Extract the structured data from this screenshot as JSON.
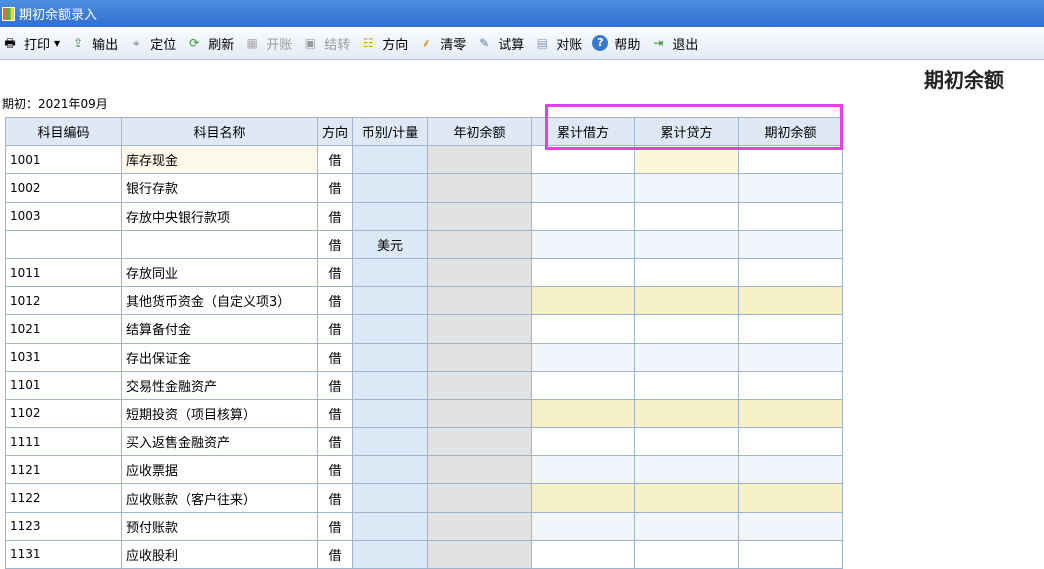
{
  "window": {
    "title": "期初余额录入"
  },
  "toolbar": {
    "items": [
      {
        "label": "打印",
        "icon": "printer-icon",
        "disabled": false,
        "dropdown": true
      },
      {
        "label": "输出",
        "icon": "export-icon",
        "disabled": false
      },
      {
        "label": "定位",
        "icon": "locate-icon",
        "disabled": false
      },
      {
        "label": "刷新",
        "icon": "refresh-icon",
        "disabled": false
      },
      {
        "label": "开账",
        "icon": "open-ledger-icon",
        "disabled": true
      },
      {
        "label": "结转",
        "icon": "carry-forward-icon",
        "disabled": true
      },
      {
        "label": "方向",
        "icon": "direction-icon",
        "disabled": false
      },
      {
        "label": "清零",
        "icon": "broom-icon",
        "disabled": false
      },
      {
        "label": "试算",
        "icon": "trial-balance-icon",
        "disabled": false
      },
      {
        "label": "对账",
        "icon": "reconcile-icon",
        "disabled": false
      },
      {
        "label": "帮助",
        "icon": "help-icon",
        "disabled": false
      },
      {
        "label": "退出",
        "icon": "exit-icon",
        "disabled": false
      }
    ]
  },
  "page": {
    "heading": "期初余额",
    "period_label": "期初：2021年09月"
  },
  "table": {
    "headers": [
      "科目编码",
      "科目名称",
      "方向",
      "币别/计量",
      "年初余额",
      "累计借方",
      "累计贷方",
      "期初余额"
    ],
    "rows": [
      {
        "code": "1001",
        "name": "库存现金",
        "dir": "借",
        "currency": ""
      },
      {
        "code": "1002",
        "name": "银行存款",
        "dir": "借",
        "currency": ""
      },
      {
        "code": "1003",
        "name": "存放中央银行款项",
        "dir": "借",
        "currency": ""
      },
      {
        "code": "",
        "name": "",
        "dir": "借",
        "currency": "美元"
      },
      {
        "code": "1011",
        "name": "存放同业",
        "dir": "借",
        "currency": ""
      },
      {
        "code": "1012",
        "name": "其他货币资金（自定义项3）",
        "dir": "借",
        "currency": ""
      },
      {
        "code": "1021",
        "name": "结算备付金",
        "dir": "借",
        "currency": ""
      },
      {
        "code": "1031",
        "name": "存出保证金",
        "dir": "借",
        "currency": ""
      },
      {
        "code": "1101",
        "name": "交易性金融资产",
        "dir": "借",
        "currency": ""
      },
      {
        "code": "1102",
        "name": "短期投资（项目核算）",
        "dir": "借",
        "currency": ""
      },
      {
        "code": "1111",
        "name": "买入返售金融资产",
        "dir": "借",
        "currency": ""
      },
      {
        "code": "1121",
        "name": "应收票据",
        "dir": "借",
        "currency": ""
      },
      {
        "code": "1122",
        "name": "应收账款（客户往来）",
        "dir": "借",
        "currency": ""
      },
      {
        "code": "1123",
        "name": "预付账款",
        "dir": "借",
        "currency": ""
      },
      {
        "code": "1131",
        "name": "应收股利",
        "dir": "借",
        "currency": ""
      }
    ]
  },
  "colors": {
    "highlight_box": "#e83ee8",
    "titlebar": "#3b7bd6"
  }
}
